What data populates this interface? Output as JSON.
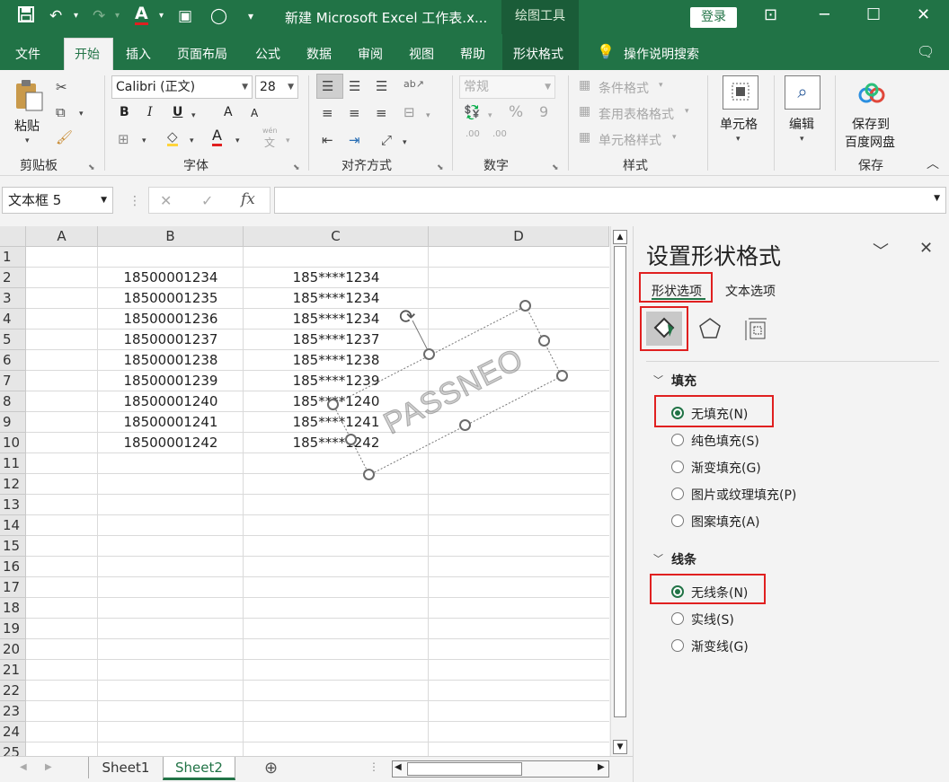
{
  "titlebar": {
    "doc_title": "新建 Microsoft Excel 工作表.x...",
    "context_tool": "绘图工具",
    "login_label": "登录",
    "icons": [
      "save-icon",
      "undo-icon",
      "redo-icon",
      "font-color-icon",
      "camera-icon",
      "circle-icon",
      "customize-icon",
      "ribbon-display-icon",
      "minimize-icon",
      "maximize-icon",
      "close-icon"
    ]
  },
  "menu": {
    "file": "文件",
    "home": "开始",
    "insert": "插入",
    "page_layout": "页面布局",
    "formulas": "公式",
    "data": "数据",
    "review": "审阅",
    "view": "视图",
    "help": "帮助",
    "shape_format": "形状格式",
    "tell_me": "操作说明搜索"
  },
  "ribbon": {
    "clipboard": {
      "paste": "粘贴",
      "label": "剪贴板"
    },
    "font": {
      "name": "Calibri (正文)",
      "size": "28",
      "label": "字体",
      "bold": "B",
      "italic": "I",
      "underline": "U",
      "grow": "A",
      "shrink": "A",
      "color": "A",
      "wen": "wén",
      "wen_char": "文"
    },
    "alignment": {
      "label": "对齐方式"
    },
    "number": {
      "format": "常规",
      "label": "数字",
      "percent": "%",
      "comma": "9",
      "inc": ".00",
      "dec": ".00"
    },
    "styles": {
      "cond": "条件格式",
      "table": "套用表格格式",
      "cell": "单元格样式",
      "label": "样式"
    },
    "cells": {
      "label": "单元格"
    },
    "editing": {
      "label": "编辑"
    },
    "save": {
      "label1": "保存到",
      "label2": "百度网盘",
      "group": "保存"
    }
  },
  "formula_bar": {
    "namebox": "文本框 5",
    "cancel": "✕",
    "enter": "✓",
    "fx": "fx",
    "content": ""
  },
  "sheet": {
    "columns": [
      "A",
      "B",
      "C",
      "D"
    ],
    "rows": [
      "1",
      "2",
      "3",
      "4",
      "5",
      "6",
      "7",
      "8",
      "9",
      "10",
      "11",
      "12",
      "13",
      "14",
      "15",
      "16",
      "17",
      "18",
      "19",
      "20",
      "21",
      "22",
      "23",
      "24",
      "25"
    ],
    "data": [
      [
        "18500001234",
        "185****1234"
      ],
      [
        "18500001235",
        "185****1234"
      ],
      [
        "18500001236",
        "185****1234"
      ],
      [
        "18500001237",
        "185****1237"
      ],
      [
        "18500001238",
        "185****1238"
      ],
      [
        "18500001239",
        "185****1239"
      ],
      [
        "18500001240",
        "185****1240"
      ],
      [
        "18500001241",
        "185****1241"
      ],
      [
        "18500001242",
        "185****1242"
      ]
    ],
    "watermark": "PASSNEO",
    "tabs": [
      "Sheet1",
      "Sheet2"
    ],
    "active_tab": "Sheet2"
  },
  "pane": {
    "title": "设置形状格式",
    "tab_shape": "形状选项",
    "tab_text": "文本选项",
    "fill_header": "填充",
    "fill_options": [
      "无填充(N)",
      "纯色填充(S)",
      "渐变填充(G)",
      "图片或纹理填充(P)",
      "图案填充(A)"
    ],
    "line_header": "线条",
    "line_options": [
      "无线条(N)",
      "实线(S)",
      "渐变线(G)"
    ]
  },
  "colors": {
    "accent": "#217346",
    "highlight": "#e02020"
  }
}
